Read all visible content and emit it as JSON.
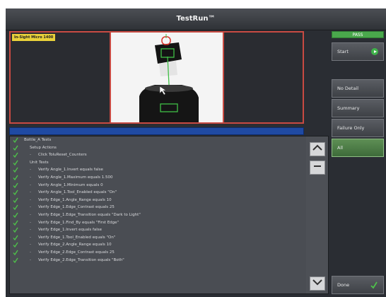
{
  "window": {
    "title": "TestRun™"
  },
  "camera": {
    "label": "In-Sight Micro 1400"
  },
  "sidebar": {
    "status_badge": "PASS",
    "start_label": "Start",
    "filter_buttons": [
      "No Detail",
      "Summary",
      "Failure Only",
      "All"
    ],
    "selected_filter": "All",
    "done_label": "Done"
  },
  "results": {
    "rows": [
      {
        "level": 0,
        "text": "Bottle_A Tests"
      },
      {
        "level": 1,
        "text": "Setup Actions"
      },
      {
        "level": 2,
        "text": "Click ToluReset_Counters"
      },
      {
        "level": 1,
        "text": "Unit Tests"
      },
      {
        "level": 2,
        "text": "Verify Angle_1.Invert equals false"
      },
      {
        "level": 2,
        "text": "Verify Angle_1.Maximum equals 1.500"
      },
      {
        "level": 2,
        "text": "Verify Angle_1.Minimum equals 0"
      },
      {
        "level": 2,
        "text": "Verify Angle_1.Tool_Enabled equals \"On\""
      },
      {
        "level": 2,
        "text": "Verify Edge_1.Angle_Range equals 10"
      },
      {
        "level": 2,
        "text": "Verify Edge_1.Edge_Contrast equals 25"
      },
      {
        "level": 2,
        "text": "Verify Edge_1.Edge_Transition equals \"Dark to Light\""
      },
      {
        "level": 2,
        "text": "Verify Edge_1.Find_By equals \"First Edge\""
      },
      {
        "level": 2,
        "text": "Verify Edge_1.Invert equals false"
      },
      {
        "level": 2,
        "text": "Verify Edge_1.Tool_Enabled equals \"On\""
      },
      {
        "level": 2,
        "text": "Verify Edge_2.Angle_Range equals 10"
      },
      {
        "level": 2,
        "text": "Verify Edge_2.Edge_Contrast equals 25"
      },
      {
        "level": 2,
        "text": "Verify Edge_2.Edge_Transition equals \"Both\""
      }
    ]
  },
  "icons": {
    "check": "check-icon",
    "play": "play-icon",
    "scroll_up": "chevron-up-icon",
    "collapse": "minus-icon",
    "scroll_down": "chevron-down-icon"
  },
  "colors": {
    "pass": "#4aa84c",
    "check": "#4ec24a",
    "camera_border": "#c84a42",
    "progress": "#1f4aa3"
  }
}
